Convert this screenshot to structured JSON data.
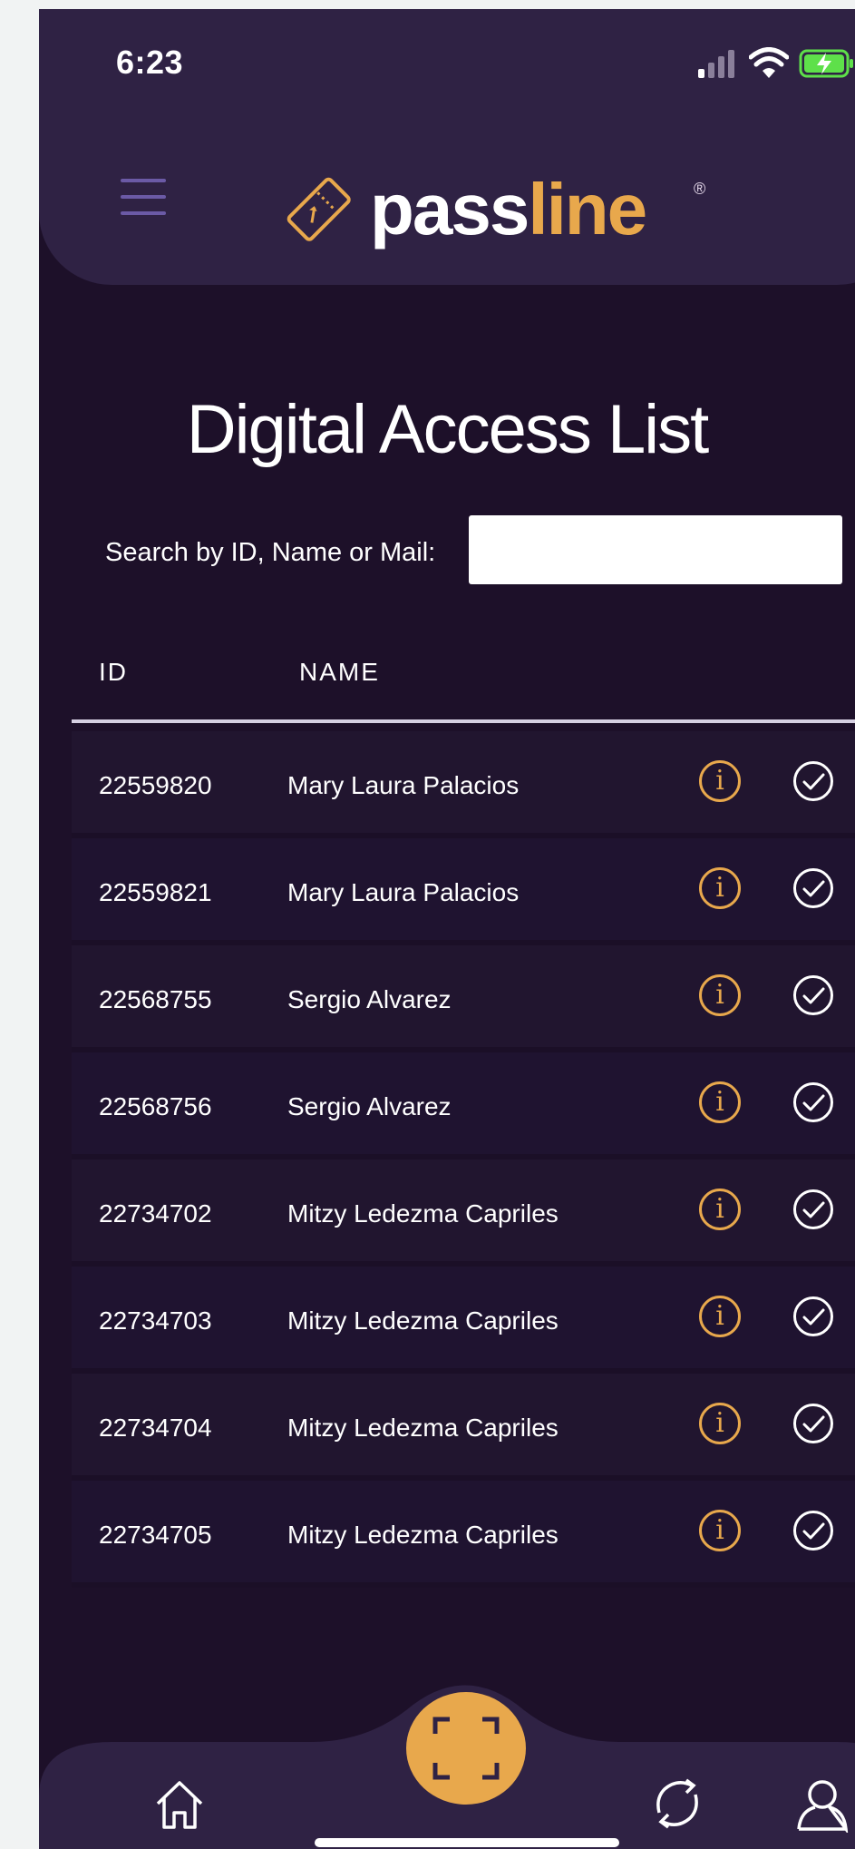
{
  "status_bar": {
    "time": "6:23"
  },
  "header": {
    "logo_pass": "pass",
    "logo_line": "line",
    "logo_mark": "®"
  },
  "page": {
    "title": "Digital Access List"
  },
  "search": {
    "label": "Search by ID, Name or Mail:",
    "value": "",
    "placeholder": ""
  },
  "table": {
    "columns": [
      "ID",
      "NAME"
    ],
    "rows": [
      {
        "id": "22559820",
        "name": "Mary Laura Palacios"
      },
      {
        "id": "22559821",
        "name": "Mary Laura Palacios"
      },
      {
        "id": "22568755",
        "name": "Sergio Alvarez"
      },
      {
        "id": "22568756",
        "name": "Sergio Alvarez"
      },
      {
        "id": "22734702",
        "name": "Mitzy Ledezma Capriles"
      },
      {
        "id": "22734703",
        "name": "Mitzy Ledezma Capriles"
      },
      {
        "id": "22734704",
        "name": "Mitzy Ledezma Capriles"
      },
      {
        "id": "22734705",
        "name": "Mitzy Ledezma Capriles"
      }
    ],
    "row_icons": [
      "info-icon",
      "check-circle-icon"
    ]
  },
  "icons": {
    "status": [
      "cellular-signal-icon",
      "wifi-icon",
      "battery-charging-icon"
    ],
    "header": [
      "hamburger-menu-icon",
      "ticket-logo-icon"
    ],
    "nav": [
      "home-icon",
      "scan-icon",
      "sync-icon",
      "profile-icon"
    ]
  },
  "colors": {
    "background": "#1d1029",
    "header": "#2f2244",
    "accent": "#e8a84c",
    "menu_icon": "#6b5aa6",
    "battery": "#5ee04a",
    "text": "#ffffff"
  }
}
